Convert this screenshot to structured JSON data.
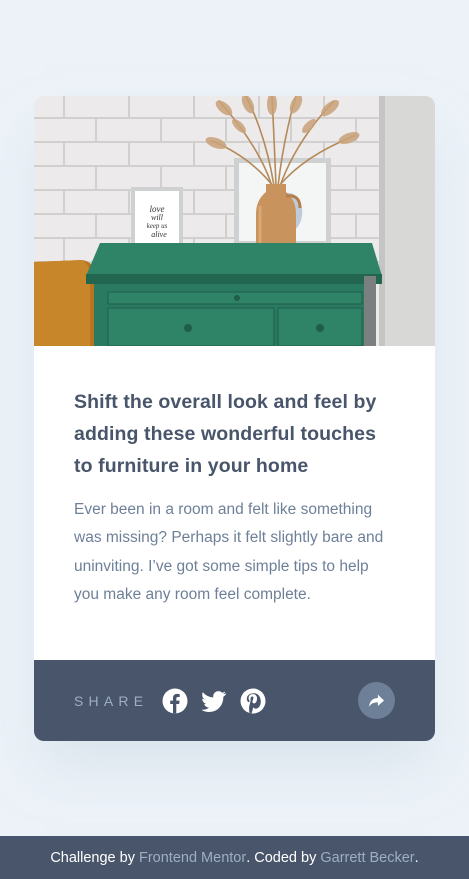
{
  "card": {
    "image_alt": "drawers",
    "frame_text": [
      "love",
      "will",
      "keep us",
      "alive"
    ],
    "title": "Shift the overall look and feel by adding these wonderful touches to furniture in your home",
    "description": "Ever been in a room and felt like something was missing? Perhaps it felt slightly bare and uninviting. I’ve got some simple tips to help you make any room feel complete."
  },
  "share": {
    "label": "SHARE",
    "icons": [
      "facebook-icon",
      "twitter-icon",
      "pinterest-icon"
    ],
    "toggle_icon": "share-arrow-icon"
  },
  "attribution": {
    "prefix": "Challenge by ",
    "challenge_link": "Frontend Mentor",
    "middle": ". Coded by ",
    "author_link": "Garrett Becker",
    "suffix": "."
  },
  "colors": {
    "page_background": "#ecf2f8",
    "dark_blue": "#48556a",
    "grayish_blue": "#6e8098",
    "light_grayish_blue": "#9eafc2",
    "dresser_green": "#2a7a62"
  }
}
